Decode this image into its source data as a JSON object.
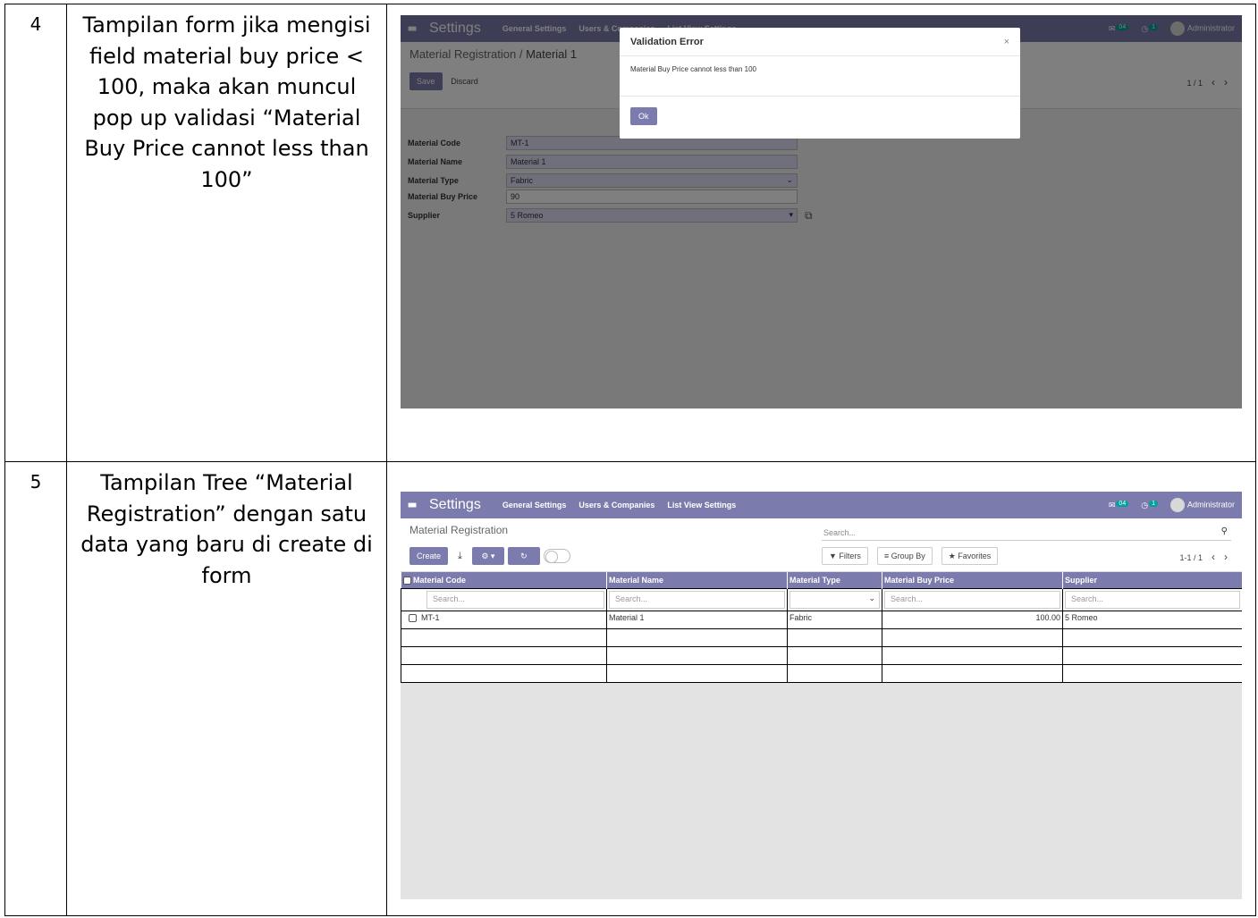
{
  "rows": [
    {
      "number": "4",
      "description": "Tampilan form jika mengisi field material buy price < 100, maka akan muncul pop up validasi “Material Buy Price cannot less than 100”"
    },
    {
      "number": "5",
      "description": "Tampilan Tree “Material Registration” dengan satu data yang baru di create di form"
    }
  ],
  "nav": {
    "app_name": "Settings",
    "menus": [
      "General Settings",
      "Users & Companies",
      "List View Settings"
    ],
    "msg_count": "04",
    "activity_count": "1",
    "user": "Administrator"
  },
  "form": {
    "breadcrumb_parent": "Material Registration",
    "breadcrumb_sep": " / ",
    "breadcrumb_current": "Material 1",
    "save": "Save",
    "discard": "Discard",
    "pager": "1 / 1",
    "fields": [
      {
        "label": "Material Code",
        "value": "MT-1"
      },
      {
        "label": "Material Name",
        "value": "Material 1"
      },
      {
        "label": "Material Type",
        "value": "Fabric"
      },
      {
        "label": "Material Buy Price",
        "value": "90"
      },
      {
        "label": "Supplier",
        "value": "5 Romeo"
      }
    ],
    "modal": {
      "title": "Validation Error",
      "close": "×",
      "message": "Material Buy Price cannot less than 100",
      "ok": "Ok"
    }
  },
  "list": {
    "title": "Material Registration",
    "search_placeholder": "Search...",
    "create": "Create",
    "filters": "Filters",
    "group_by": "Group By",
    "favorites": "Favorites",
    "pager": "1-1 / 1",
    "columns": [
      "Material Code",
      "Material Name",
      "Material Type",
      "Material Buy Price",
      "Supplier"
    ],
    "filter_placeholder": "Search...",
    "records": [
      {
        "code": "MT-1",
        "name": "Material 1",
        "type": "Fabric",
        "price": "100.00",
        "supplier": "5 Romeo"
      }
    ]
  },
  "colors": {
    "navbar": "#7c7bad",
    "badge": "#00a09d"
  }
}
